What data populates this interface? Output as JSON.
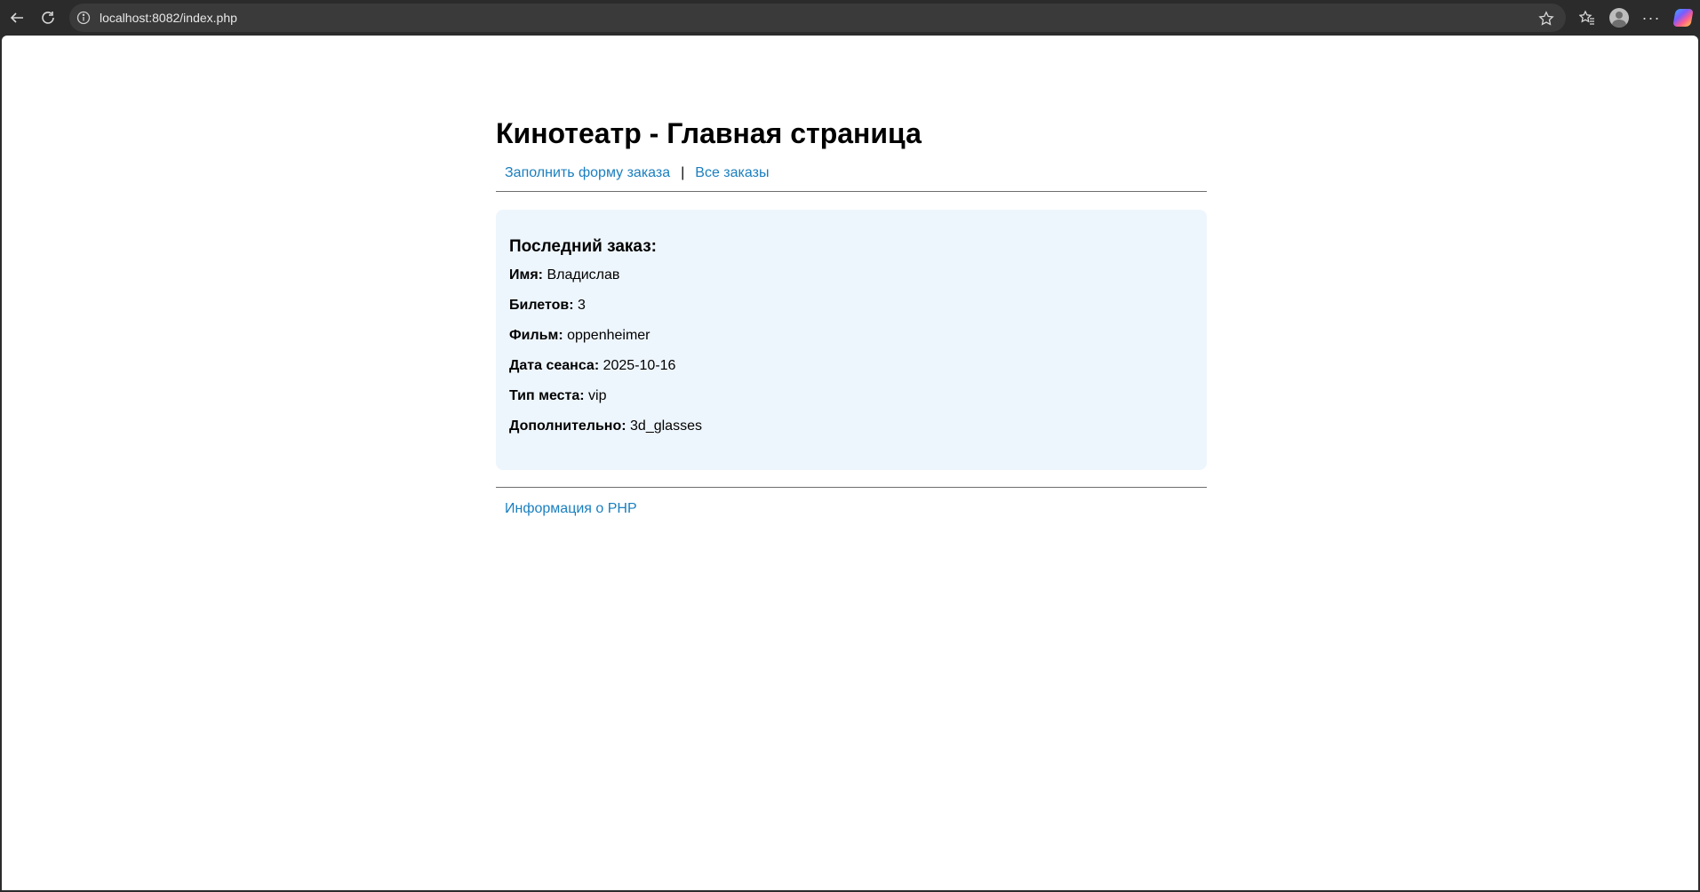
{
  "browser": {
    "url": "localhost:8082/index.php",
    "icons": {
      "back": "back-arrow-icon",
      "reload": "reload-icon",
      "info": "info-icon",
      "star": "star-icon",
      "favorites": "favorites-icon",
      "profile": "profile-icon",
      "more": "more-icon",
      "copilot": "copilot-icon"
    },
    "more_label": "···"
  },
  "page": {
    "title": "Кинотеатр - Главная страница",
    "nav": {
      "order_form_link": "Заполнить форму заказа",
      "separator": "|",
      "all_orders_link": "Все заказы"
    },
    "last_order": {
      "heading": "Последний заказ:",
      "rows": [
        {
          "label": "Имя:",
          "value": "Владислав"
        },
        {
          "label": "Билетов:",
          "value": "3"
        },
        {
          "label": "Фильм:",
          "value": "oppenheimer"
        },
        {
          "label": "Дата сеанса:",
          "value": "2025-10-16"
        },
        {
          "label": "Тип места:",
          "value": "vip"
        },
        {
          "label": "Дополнительно:",
          "value": "3d_glasses"
        }
      ]
    },
    "footer": {
      "php_info_link": "Информация о PHP"
    }
  },
  "colors": {
    "link": "#1a7fbf",
    "order_box_bg": "#eef6fd",
    "chrome_bg": "#2b2b2b",
    "address_bar_bg": "#3a3a3a"
  }
}
